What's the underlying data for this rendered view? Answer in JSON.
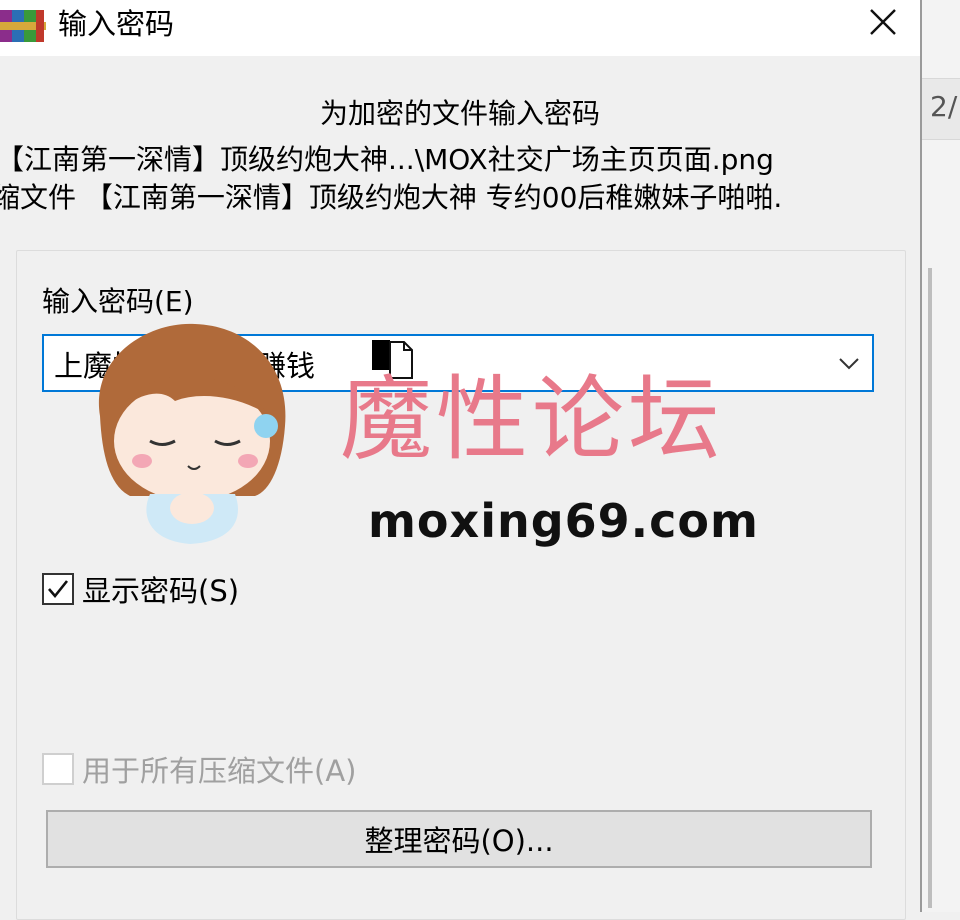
{
  "window": {
    "title": "输入密码",
    "icons": {
      "app": "winrar-books-icon",
      "close": "close-icon"
    }
  },
  "header": {
    "line1": "为加密的文件输入密码",
    "line2": "【江南第一深情】顶级约炮大神...\\MOX社交广场主页页面.png",
    "line3": "缩文件 【江南第一深情】顶级约炮大神 专约00后稚嫩妹子啪啪."
  },
  "password": {
    "label": "输入密码(E)",
    "value": "上魔性论坛看片赚钱",
    "dropdown_icon": "chevron-down-icon"
  },
  "options": {
    "show_password": {
      "label": "显示密码(S)",
      "checked": true
    },
    "use_for_all": {
      "label": "用于所有压缩文件(A)",
      "checked": false,
      "disabled": true
    }
  },
  "buttons": {
    "organize": "整理密码(O)..."
  },
  "background_window": {
    "partial_text": "2/"
  },
  "watermark": {
    "brand": "魔性论坛",
    "url": "moxing69.com",
    "colors": {
      "brand": "#e8798a",
      "url": "#111111"
    }
  },
  "colors": {
    "focus_border": "#0078d7",
    "dialog_bg": "#f0f0f0",
    "titlebar_bg": "#ffffff"
  }
}
